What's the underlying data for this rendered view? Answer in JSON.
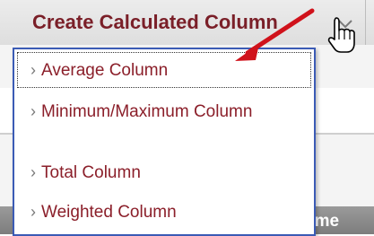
{
  "toolbar": {
    "create_label": "Create Calculated Column",
    "chevron_icon": "chevron-down-icon"
  },
  "menu": {
    "items": [
      {
        "label": "Average Column"
      },
      {
        "label": "Minimum/Maximum Column"
      },
      {
        "label": "Total Column"
      },
      {
        "label": "Weighted Column"
      }
    ]
  },
  "table": {
    "header_partial_label": "ame"
  },
  "colors": {
    "menu_text": "#8b1f2a",
    "title_text": "#7a1f28",
    "dropdown_border": "#3b5bb5",
    "arrow": "#d0121b"
  }
}
